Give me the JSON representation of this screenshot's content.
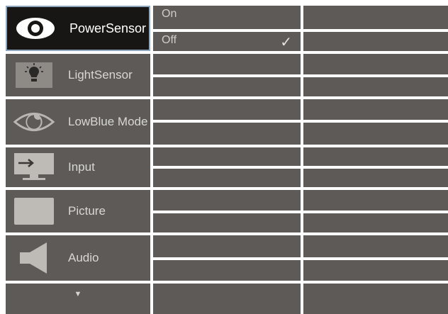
{
  "menu": {
    "items": [
      {
        "label": "PowerSensor",
        "icon": "eye-icon",
        "selected": true
      },
      {
        "label": "LightSensor",
        "icon": "lightbulb-icon",
        "selected": false
      },
      {
        "label": "LowBlue Mode",
        "icon": "eye-outline-icon",
        "selected": false
      },
      {
        "label": "Input",
        "icon": "input-icon",
        "selected": false
      },
      {
        "label": "Picture",
        "icon": "picture-icon",
        "selected": false
      },
      {
        "label": "Audio",
        "icon": "speaker-icon",
        "selected": false
      }
    ],
    "scroll_down_glyph": "▼"
  },
  "submenu": {
    "options": [
      {
        "label": "On",
        "checked": false
      },
      {
        "label": "Off",
        "checked": true
      }
    ],
    "check_glyph": "✓"
  },
  "colors": {
    "cell_bg": "#5d5a57",
    "selected_bg": "#171615",
    "selected_border": "#8fa8bf",
    "text": "#d9d7d3",
    "grid_lines": "#ffffff"
  }
}
